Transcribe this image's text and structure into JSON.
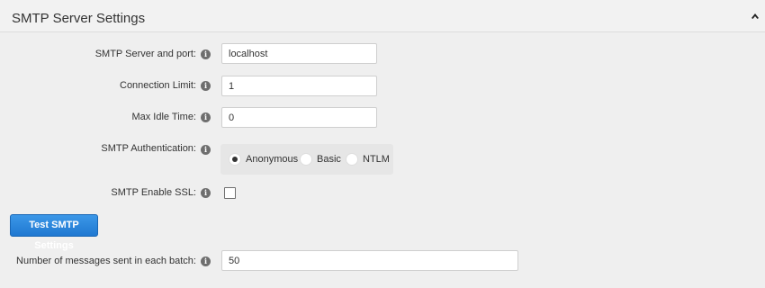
{
  "panel": {
    "title": "SMTP Server Settings",
    "collapse_icon": "chevron-up-icon"
  },
  "fields": {
    "server_port": {
      "label": "SMTP Server and port:",
      "value": "localhost"
    },
    "connection_limit": {
      "label": "Connection Limit:",
      "value": "1"
    },
    "max_idle_time": {
      "label": "Max Idle Time:",
      "value": "0"
    },
    "authentication": {
      "label": "SMTP Authentication:",
      "options": [
        "Anonymous",
        "Basic",
        "NTLM"
      ],
      "selected": "Anonymous"
    },
    "enable_ssl": {
      "label": "SMTP Enable SSL:",
      "checked": false
    },
    "batch_size": {
      "label": "Number of messages sent in each batch:",
      "value": "50"
    }
  },
  "info_icon": {
    "glyph": "i",
    "icon": "info-icon"
  },
  "buttons": {
    "test_smtp": "Test SMTP Settings"
  },
  "colors": {
    "primary_button": "#2583dc",
    "background": "#efefef"
  }
}
